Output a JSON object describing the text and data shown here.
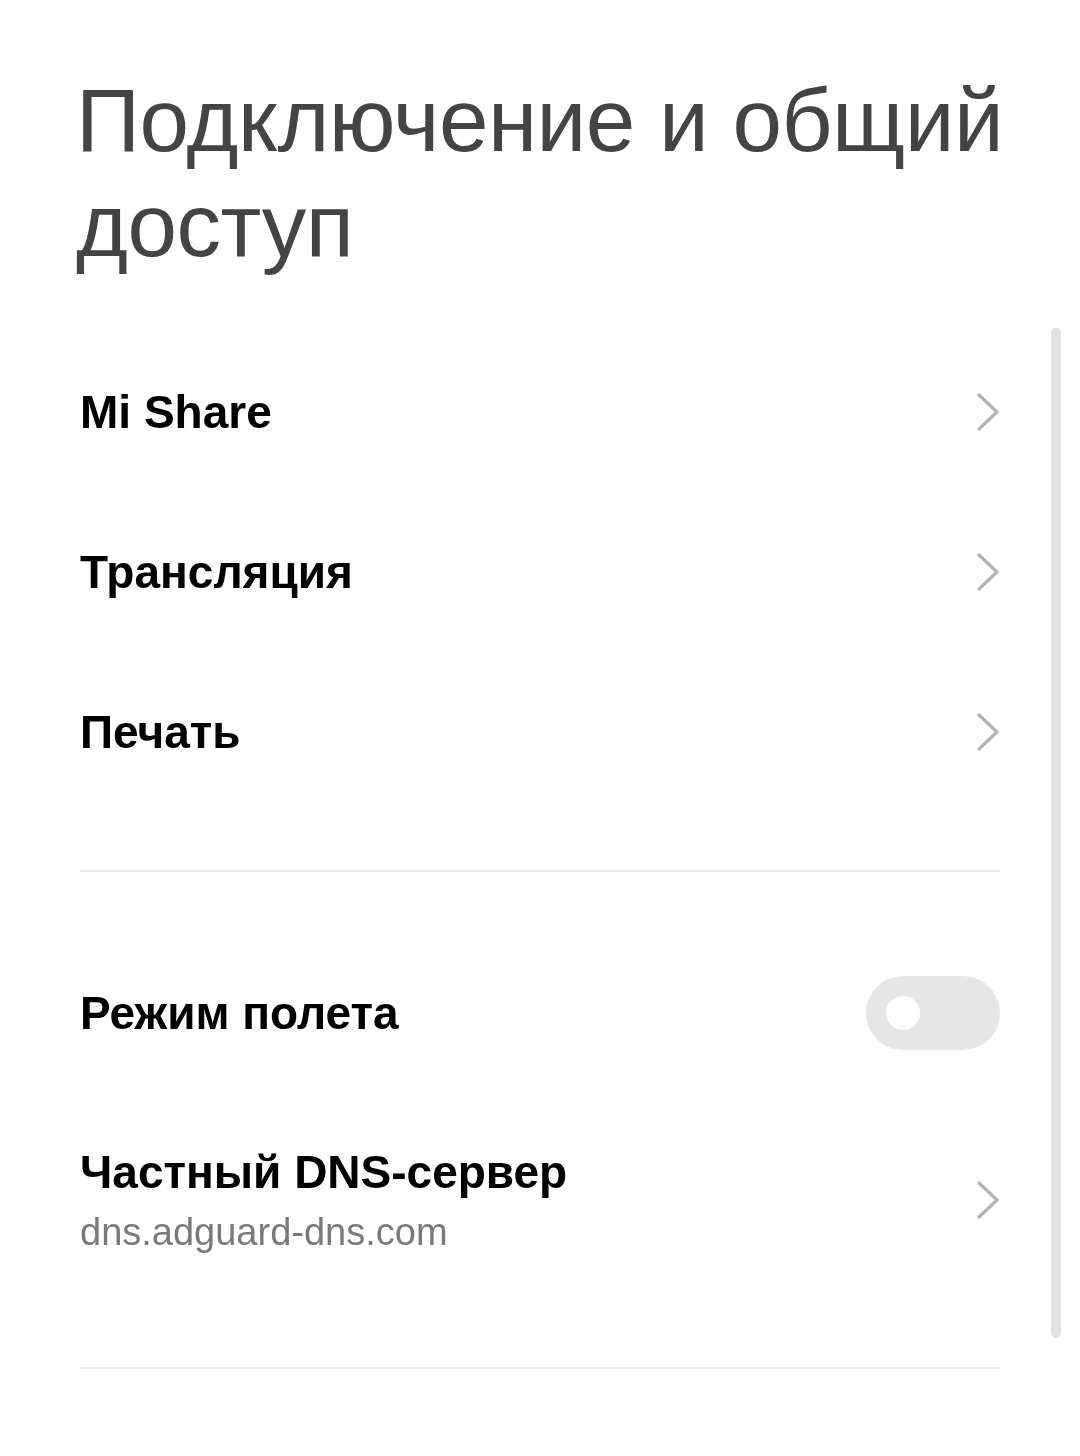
{
  "title": "Подключение и общий доступ",
  "groups": [
    {
      "items": [
        {
          "kind": "link",
          "label": "Mi Share"
        },
        {
          "kind": "link",
          "label": "Трансляция"
        },
        {
          "kind": "link",
          "label": "Печать"
        }
      ]
    },
    {
      "items": [
        {
          "kind": "toggle",
          "label": "Режим полета",
          "on": false
        },
        {
          "kind": "link",
          "label": "Частный DNS-сервер",
          "subtitle": "dns.adguard-dns.com"
        }
      ]
    }
  ]
}
